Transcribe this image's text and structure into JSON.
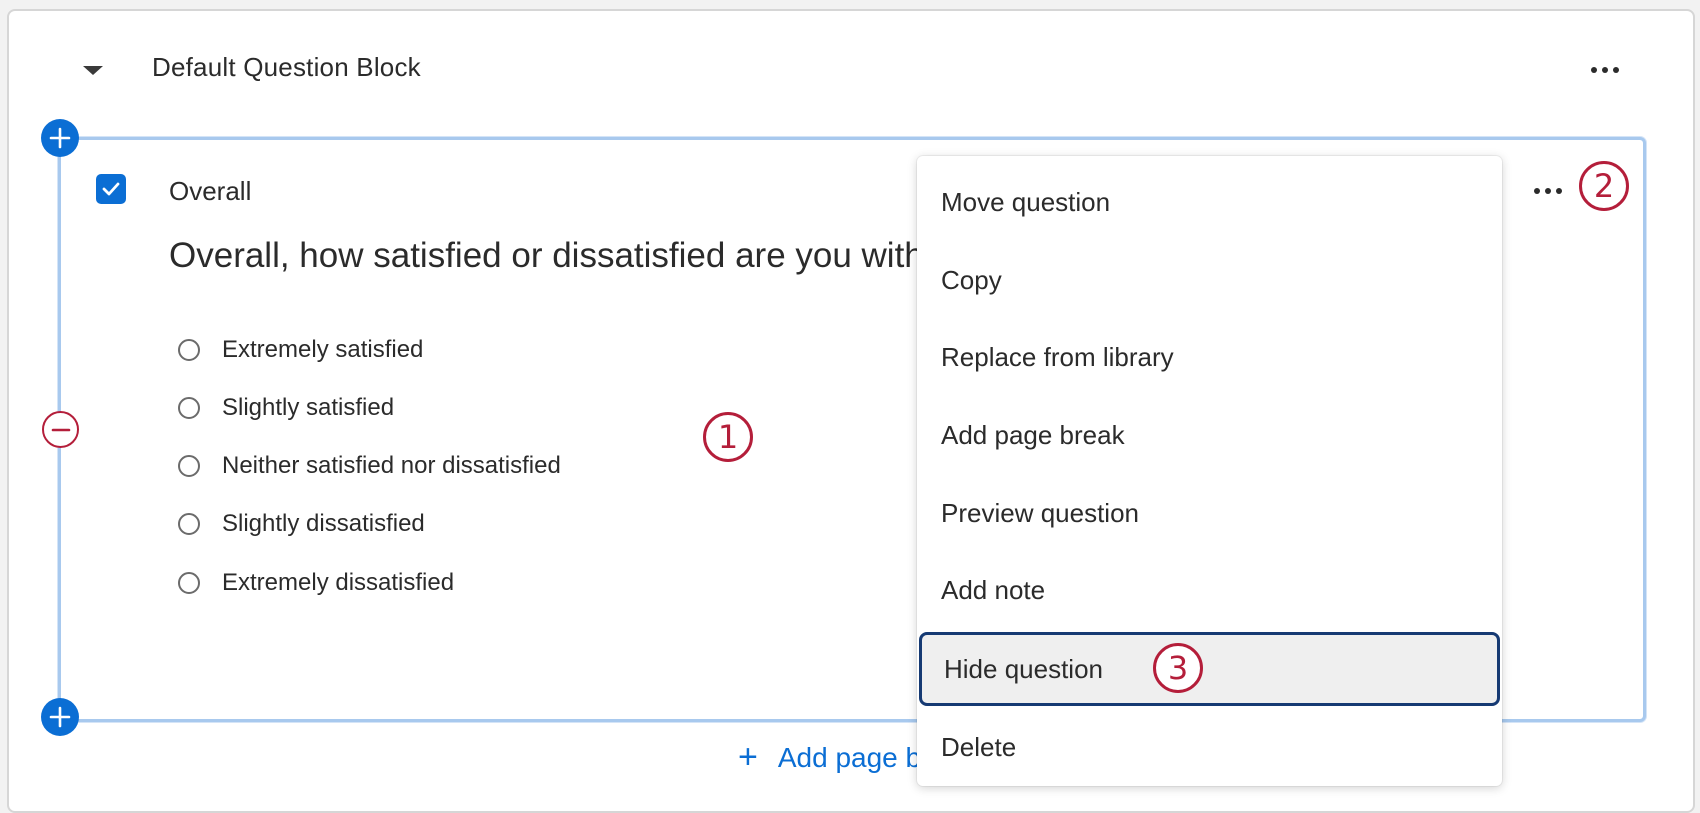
{
  "block": {
    "title": "Default Question Block",
    "menu_icon": "more-horizontal-icon"
  },
  "question": {
    "label": "Overall",
    "text": "Overall, how satisfied or dissatisfied are you with",
    "selected": true,
    "choices": [
      "Extremely satisfied",
      "Slightly satisfied",
      "Neither satisfied nor dissatisfied",
      "Slightly dissatisfied",
      "Extremely dissatisfied"
    ]
  },
  "context_menu": {
    "items": [
      "Move question",
      "Copy",
      "Replace from library",
      "Add page break",
      "Preview question",
      "Add note",
      "Hide question",
      "Delete"
    ],
    "highlighted": "Hide question"
  },
  "add_page_break": {
    "label": "Add page break"
  },
  "callouts": [
    "1",
    "2",
    "3"
  ],
  "colors": {
    "accent": "#0b6ed4",
    "callout": "#b41e3a",
    "highlight_border": "#163a73",
    "question_border": "#a8c9ee"
  }
}
